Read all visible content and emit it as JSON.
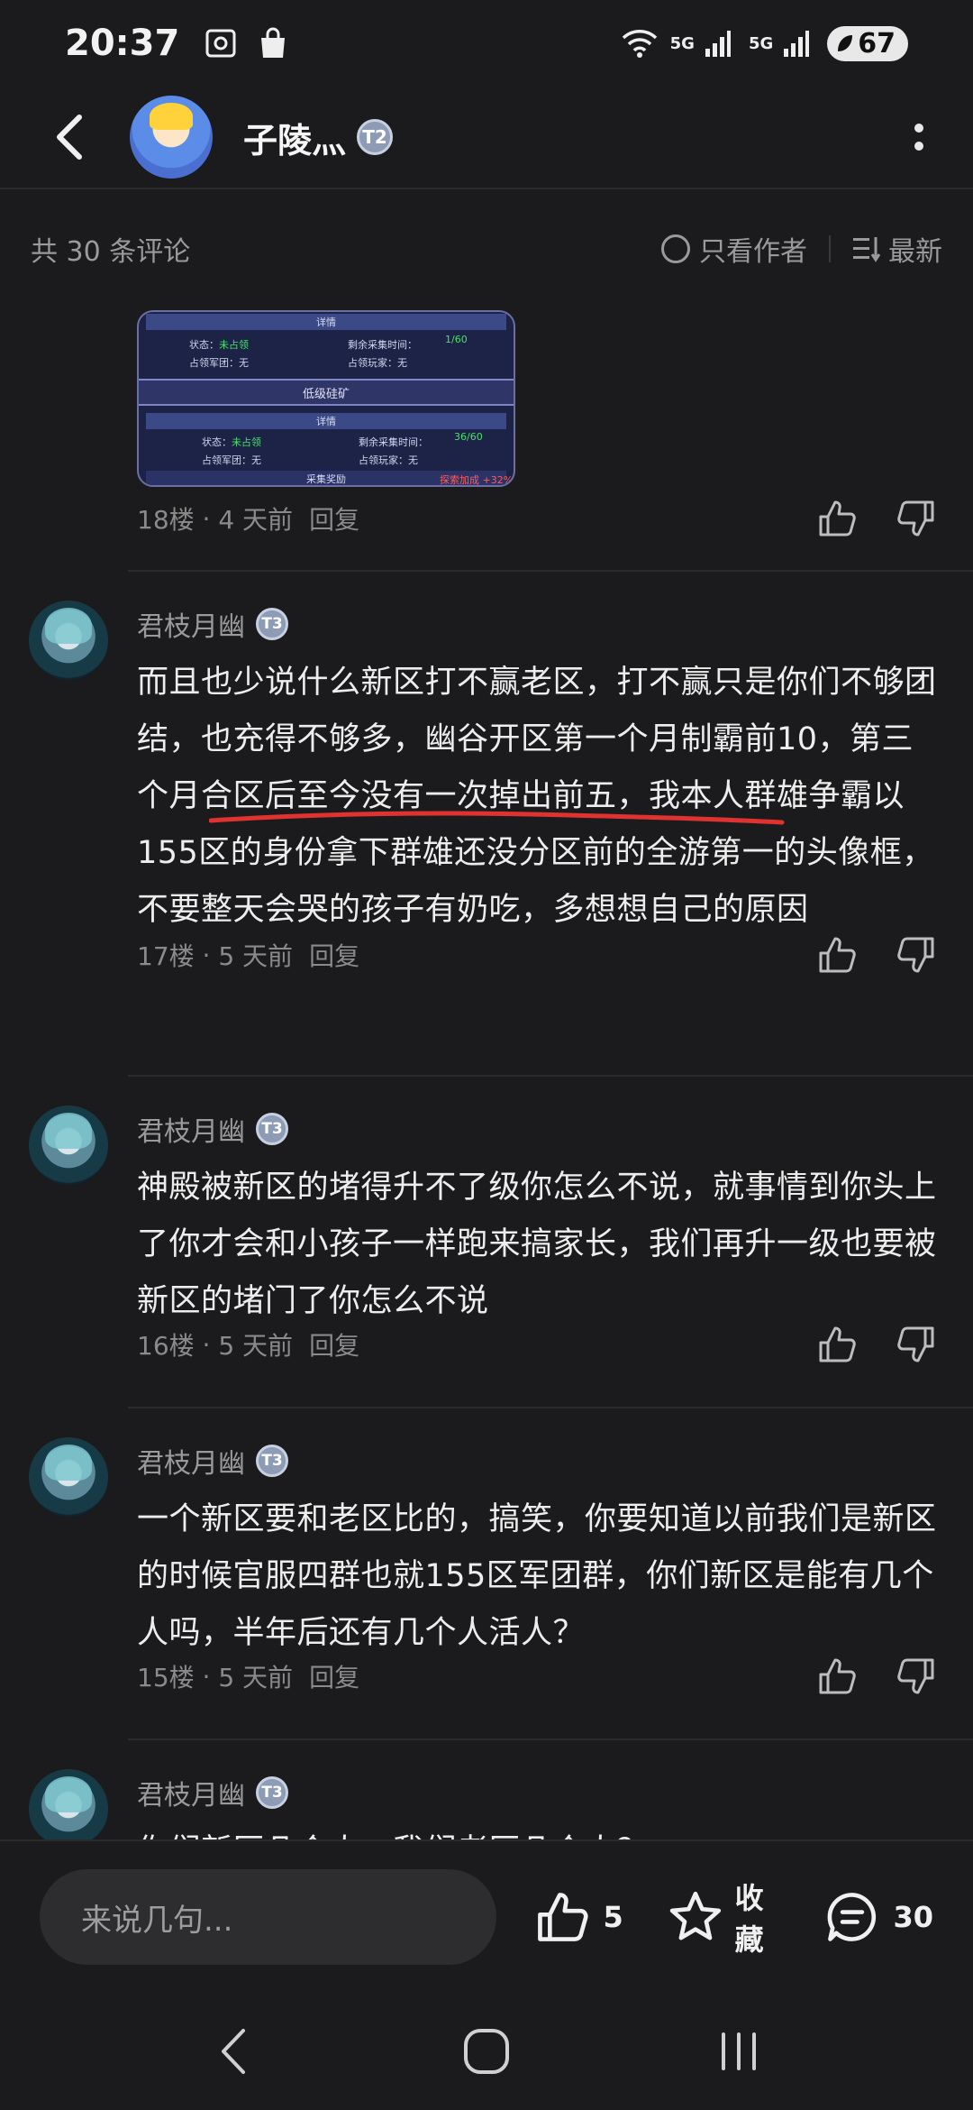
{
  "status_bar": {
    "time": "20:37",
    "net1": "5G",
    "net2": "5G",
    "battery": "67"
  },
  "header": {
    "name": "子陵灬",
    "level": "T2"
  },
  "filter": {
    "count_text": "共 30 条评论",
    "only_author": "只看作者",
    "sort": "最新"
  },
  "image_comment": {
    "thumb": {
      "detail1": "详情",
      "status_label": "状态：",
      "status_val": "未占领",
      "remain_label": "剩余采集时间：",
      "remain_val": "1/60",
      "army_label": "占领军团：无",
      "player_label": "占领玩家：无",
      "section": "低级硅矿",
      "detail2": "详情",
      "remain_val2": "36/60",
      "reward": "采集奖励",
      "bonus": "探索加成 +32%"
    },
    "floor": "18楼",
    "time": "4 天前",
    "reply": "回复"
  },
  "comments": [
    {
      "author": "君枝月幽",
      "level": "T3",
      "text": "而且也少说什么新区打不赢老区，打不赢只是你们不够团结，也充得不够多，幽谷开区第一个月制霸前10，第三个月合区后至今没有一次掉出前五，我本人群雄争霸以155区的身份拿下群雄还没分区前的全游第一的头像框，不要整天会哭的孩子有奶吃，多想想自己的原因",
      "floor": "17楼",
      "time": "5 天前",
      "reply": "回复"
    },
    {
      "author": "君枝月幽",
      "level": "T3",
      "text": "神殿被新区的堵得升不了级你怎么不说，就事情到你头上了你才会和小孩子一样跑来搞家长，我们再升一级也要被新区的堵门了你怎么不说",
      "floor": "16楼",
      "time": "5 天前",
      "reply": "回复"
    },
    {
      "author": "君枝月幽",
      "level": "T3",
      "text": "一个新区要和老区比的，搞笑，你要知道以前我们是新区的时候官服四群也就155区军团群，你们新区是能有几个人吗，半年后还有几个人活人？",
      "floor": "15楼",
      "time": "5 天前",
      "reply": "回复"
    },
    {
      "author": "君枝月幽",
      "level": "T3",
      "text": "你们新区几个人，我们老区几个人？"
    }
  ],
  "bottom_bar": {
    "placeholder": "来说几句...",
    "likes": "5",
    "favorite": "收藏",
    "comments": "30"
  },
  "colors": {
    "background": "#1b1b1d",
    "underline": "#e0322e"
  }
}
